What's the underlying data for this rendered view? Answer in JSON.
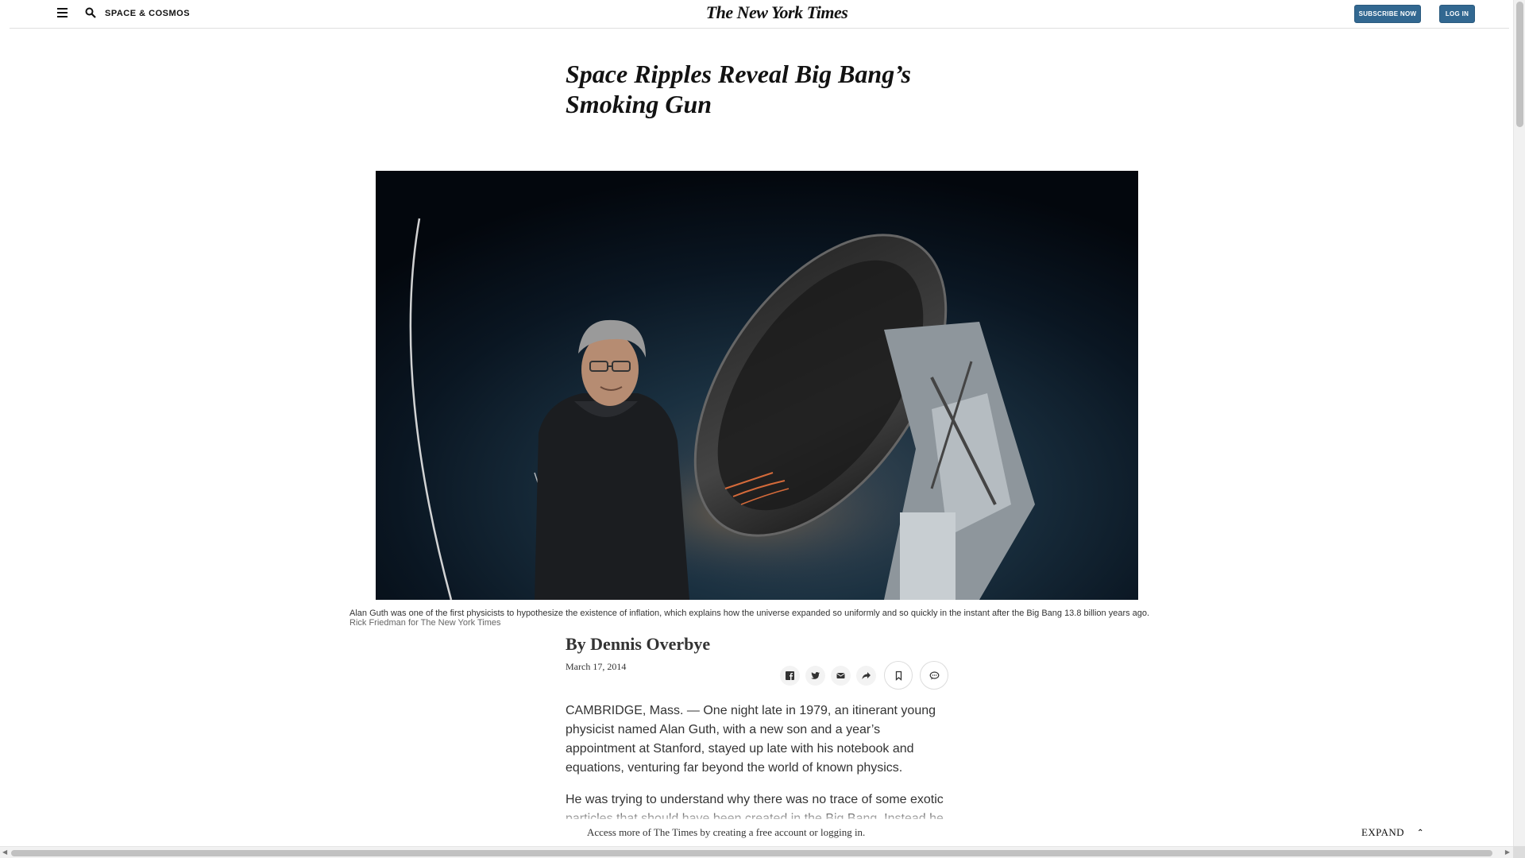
{
  "header": {
    "section": "SPACE & COSMOS",
    "logo": "The New York Times",
    "subscribe_label": "SUBSCRIBE NOW",
    "login_label": "LOG IN",
    "accent_color": "#326891"
  },
  "article": {
    "headline": "Space Ripples Reveal Big Bang’s Smoking Gun",
    "caption": "Alan Guth was one of the first physicists to hypothesize the existence of inflation, which explains how the universe expanded so uniformly and so quickly in the instant after the Big Bang 13.8 billion years ago.",
    "credit": "Rick Friedman for The New York Times",
    "byline": "By Dennis Overbye",
    "date": "March 17, 2014",
    "paragraphs": [
      "CAMBRIDGE, Mass. — One night late in 1979, an itinerant young physicist named Alan Guth, with a new son and a year’s appointment at Stanford, stayed up late with his notebook and equations, venturing far beyond the world of known physics.",
      "He was trying to understand why there was no trace of some exotic particles that should have been created in the Big Bang. Instead he"
    ]
  },
  "share": {
    "icons": [
      "facebook-icon",
      "twitter-icon",
      "email-icon",
      "share-icon",
      "bookmark-icon",
      "comment-icon"
    ]
  },
  "gateway": {
    "message": "Access more of The Times by creating a free account or logging in.",
    "expand_label": "EXPAND"
  }
}
